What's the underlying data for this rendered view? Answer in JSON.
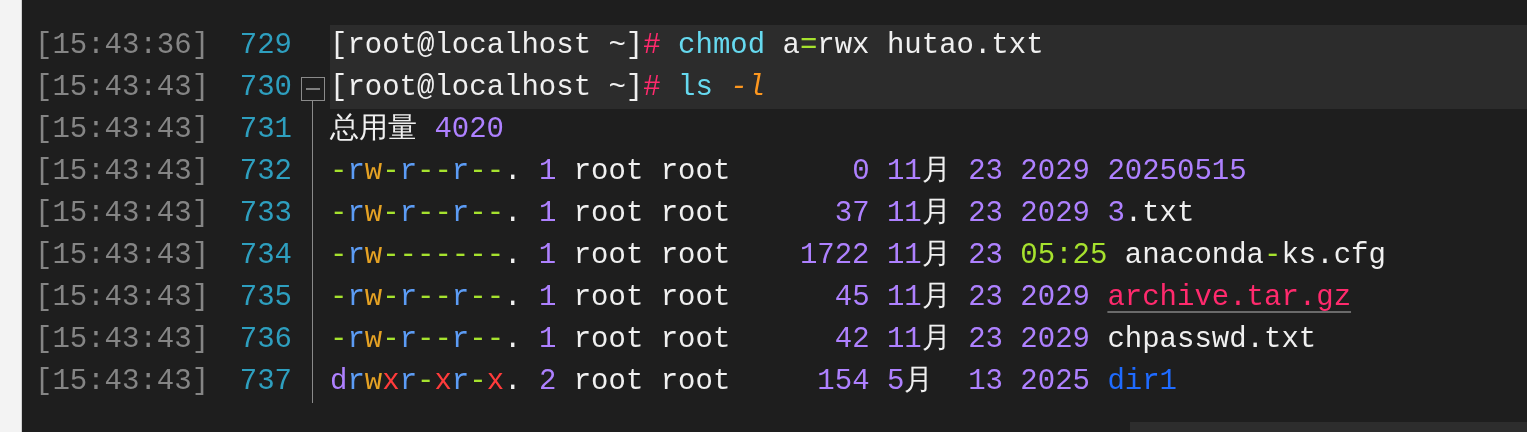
{
  "lines": [
    {
      "time": "[15:43:36]",
      "number": "729",
      "highlighted": true,
      "segments": [
        {
          "text": "[root@localhost ~]",
          "color": "#f0f0f0"
        },
        {
          "text": "#",
          "color": "#ff2a6d"
        },
        {
          "text": " chmod",
          "color": "#66d9ef"
        },
        {
          "text": " a",
          "color": "#f0f0f0"
        },
        {
          "text": "=",
          "color": "#a6e22e"
        },
        {
          "text": "rwx hutao.txt",
          "color": "#f0f0f0"
        }
      ]
    },
    {
      "time": "[15:43:43]",
      "number": "730",
      "highlighted": true,
      "fold": {
        "expanded": true
      },
      "segments": [
        {
          "text": "[root@localhost ~]",
          "color": "#f0f0f0"
        },
        {
          "text": "#",
          "color": "#ff2a6d"
        },
        {
          "text": " ls",
          "color": "#66d9ef"
        },
        {
          "text": " -l",
          "color": "#fd971f",
          "italic": true
        }
      ]
    },
    {
      "time": "[15:43:43]",
      "number": "731",
      "highlighted": false,
      "segments": [
        {
          "text": "总用量",
          "color": "#f0f0f0"
        },
        {
          "text": " 4020",
          "color": "#ae81ff"
        }
      ]
    },
    {
      "time": "[15:43:43]",
      "number": "732",
      "highlighted": false,
      "segments": [
        {
          "text": "-",
          "color": "#a6e22e"
        },
        {
          "text": "r",
          "color": "#5c9cf5"
        },
        {
          "text": "w",
          "color": "#e5a224"
        },
        {
          "text": "-",
          "color": "#a6e22e"
        },
        {
          "text": "r",
          "color": "#5c9cf5"
        },
        {
          "text": "--",
          "color": "#a6e22e"
        },
        {
          "text": "r",
          "color": "#5c9cf5"
        },
        {
          "text": "--",
          "color": "#a6e22e"
        },
        {
          "text": ". ",
          "color": "#f0f0f0"
        },
        {
          "text": "1",
          "color": "#ae81ff"
        },
        {
          "text": " root root",
          "color": "#f0f0f0"
        },
        {
          "text": "       0 11",
          "color": "#ae81ff"
        },
        {
          "text": "月",
          "color": "#f0f0f0"
        },
        {
          "text": " 23 2029 20250515",
          "color": "#ae81ff"
        }
      ]
    },
    {
      "time": "[15:43:43]",
      "number": "733",
      "highlighted": false,
      "segments": [
        {
          "text": "-",
          "color": "#a6e22e"
        },
        {
          "text": "r",
          "color": "#5c9cf5"
        },
        {
          "text": "w",
          "color": "#e5a224"
        },
        {
          "text": "-",
          "color": "#a6e22e"
        },
        {
          "text": "r",
          "color": "#5c9cf5"
        },
        {
          "text": "--",
          "color": "#a6e22e"
        },
        {
          "text": "r",
          "color": "#5c9cf5"
        },
        {
          "text": "--",
          "color": "#a6e22e"
        },
        {
          "text": ". ",
          "color": "#f0f0f0"
        },
        {
          "text": "1",
          "color": "#ae81ff"
        },
        {
          "text": " root root",
          "color": "#f0f0f0"
        },
        {
          "text": "      37 11",
          "color": "#ae81ff"
        },
        {
          "text": "月",
          "color": "#f0f0f0"
        },
        {
          "text": " 23 2029 3",
          "color": "#ae81ff"
        },
        {
          "text": ".txt",
          "color": "#f0f0f0"
        }
      ]
    },
    {
      "time": "[15:43:43]",
      "number": "734",
      "highlighted": false,
      "segments": [
        {
          "text": "-",
          "color": "#a6e22e"
        },
        {
          "text": "r",
          "color": "#5c9cf5"
        },
        {
          "text": "w",
          "color": "#e5a224"
        },
        {
          "text": "-------",
          "color": "#a6e22e"
        },
        {
          "text": ". ",
          "color": "#f0f0f0"
        },
        {
          "text": "1",
          "color": "#ae81ff"
        },
        {
          "text": " root root",
          "color": "#f0f0f0"
        },
        {
          "text": "    1722 11",
          "color": "#ae81ff"
        },
        {
          "text": "月",
          "color": "#f0f0f0"
        },
        {
          "text": " 23 ",
          "color": "#ae81ff"
        },
        {
          "text": "05:25",
          "color": "#a6e22e"
        },
        {
          "text": " anaconda",
          "color": "#f0f0f0"
        },
        {
          "text": "-",
          "color": "#a6e22e"
        },
        {
          "text": "ks.cfg",
          "color": "#f0f0f0"
        }
      ]
    },
    {
      "time": "[15:43:43]",
      "number": "735",
      "highlighted": false,
      "segments": [
        {
          "text": "-",
          "color": "#a6e22e"
        },
        {
          "text": "r",
          "color": "#5c9cf5"
        },
        {
          "text": "w",
          "color": "#e5a224"
        },
        {
          "text": "-",
          "color": "#a6e22e"
        },
        {
          "text": "r",
          "color": "#5c9cf5"
        },
        {
          "text": "--",
          "color": "#a6e22e"
        },
        {
          "text": "r",
          "color": "#5c9cf5"
        },
        {
          "text": "--",
          "color": "#a6e22e"
        },
        {
          "text": ". ",
          "color": "#f0f0f0"
        },
        {
          "text": "1",
          "color": "#ae81ff"
        },
        {
          "text": " root root",
          "color": "#f0f0f0"
        },
        {
          "text": "      45 11",
          "color": "#ae81ff"
        },
        {
          "text": "月",
          "color": "#f0f0f0"
        },
        {
          "text": " 23 2029 ",
          "color": "#ae81ff"
        },
        {
          "text": "archive.tar.gz",
          "color": "#ff2a6d",
          "underline": true
        }
      ]
    },
    {
      "time": "[15:43:43]",
      "number": "736",
      "highlighted": false,
      "segments": [
        {
          "text": "-",
          "color": "#a6e22e"
        },
        {
          "text": "r",
          "color": "#5c9cf5"
        },
        {
          "text": "w",
          "color": "#e5a224"
        },
        {
          "text": "-",
          "color": "#a6e22e"
        },
        {
          "text": "r",
          "color": "#5c9cf5"
        },
        {
          "text": "--",
          "color": "#a6e22e"
        },
        {
          "text": "r",
          "color": "#5c9cf5"
        },
        {
          "text": "--",
          "color": "#a6e22e"
        },
        {
          "text": ". ",
          "color": "#f0f0f0"
        },
        {
          "text": "1",
          "color": "#ae81ff"
        },
        {
          "text": " root root",
          "color": "#f0f0f0"
        },
        {
          "text": "      42 11",
          "color": "#ae81ff"
        },
        {
          "text": "月",
          "color": "#f0f0f0"
        },
        {
          "text": " 23 2029 ",
          "color": "#ae81ff"
        },
        {
          "text": "chpasswd.txt",
          "color": "#f0f0f0"
        }
      ]
    },
    {
      "time": "[15:43:43]",
      "number": "737",
      "highlighted": false,
      "segments": [
        {
          "text": "d",
          "color": "#ae81ff"
        },
        {
          "text": "r",
          "color": "#5c9cf5"
        },
        {
          "text": "w",
          "color": "#e5a224"
        },
        {
          "text": "x",
          "color": "#ff3b3b"
        },
        {
          "text": "r",
          "color": "#5c9cf5"
        },
        {
          "text": "-",
          "color": "#a6e22e"
        },
        {
          "text": "x",
          "color": "#ff3b3b"
        },
        {
          "text": "r",
          "color": "#5c9cf5"
        },
        {
          "text": "-",
          "color": "#a6e22e"
        },
        {
          "text": "x",
          "color": "#ff3b3b"
        },
        {
          "text": ". ",
          "color": "#f0f0f0"
        },
        {
          "text": "2",
          "color": "#ae81ff"
        },
        {
          "text": " root root",
          "color": "#f0f0f0"
        },
        {
          "text": "     154 5",
          "color": "#ae81ff"
        },
        {
          "text": "月",
          "color": "#f0f0f0"
        },
        {
          "text": "  13 2025 ",
          "color": "#ae81ff"
        },
        {
          "text": "dir1",
          "color": "#1f6bff"
        }
      ]
    }
  ]
}
